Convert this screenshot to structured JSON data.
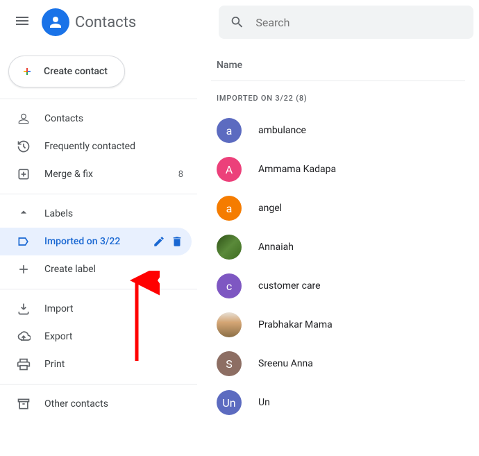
{
  "header": {
    "title": "Contacts"
  },
  "search": {
    "placeholder": "Search"
  },
  "sidebar": {
    "create_label": "Create contact",
    "nav": [
      {
        "icon": "person",
        "label": "Contacts"
      },
      {
        "icon": "history",
        "label": "Frequently contacted"
      },
      {
        "icon": "merge",
        "label": "Merge & fix",
        "count": "8"
      }
    ],
    "labels_header": "Labels",
    "labels": [
      {
        "icon": "label",
        "label": "Imported on 3/22",
        "selected": true
      }
    ],
    "create_label_label": "Create label",
    "import_label": "Import",
    "export_label": "Export",
    "print_label": "Print",
    "other_label": "Other contacts"
  },
  "main": {
    "column_header": "Name",
    "group_label": "IMPORTED ON 3/22 (8)",
    "contacts": [
      {
        "initial": "a",
        "name": "ambulance",
        "color": "#5c6bc0"
      },
      {
        "initial": "A",
        "name": "Ammama Kadapa",
        "color": "#ec407a"
      },
      {
        "initial": "a",
        "name": "angel",
        "color": "#f57c00"
      },
      {
        "initial": "",
        "name": "Annaiah",
        "photo": "photo1"
      },
      {
        "initial": "c",
        "name": "customer care",
        "color": "#7e57c2"
      },
      {
        "initial": "",
        "name": "Prabhakar Mama",
        "photo": "photo2"
      },
      {
        "initial": "S",
        "name": "Sreenu Anna",
        "color": "#8d6e63"
      },
      {
        "initial": "Un",
        "name": "Un",
        "color": "#5c6bc0"
      }
    ]
  }
}
